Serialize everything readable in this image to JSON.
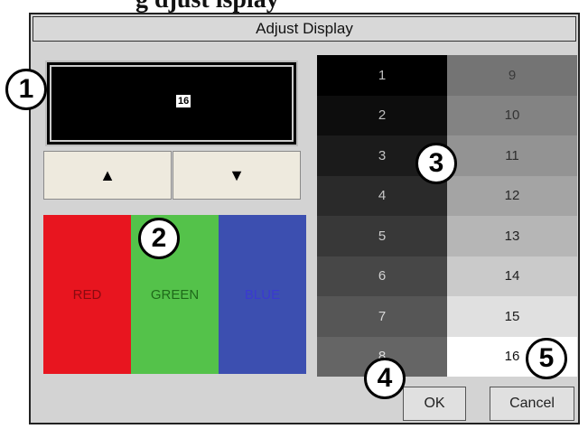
{
  "clipped_title": "g   djust   isplay",
  "window": {
    "title": "Adjust Display"
  },
  "preview": {
    "value": "16"
  },
  "arrows": {
    "up": "▲",
    "down": "▼"
  },
  "swatches": [
    {
      "label": "RED",
      "bg": "#e8151f",
      "fg": "#8a0a10"
    },
    {
      "label": "GREEN",
      "bg": "#54c24a",
      "fg": "#1f6a1a"
    },
    {
      "label": "BLUE",
      "bg": "#3c4fb0",
      "fg": "#3a3ad0"
    }
  ],
  "levels": [
    {
      "n": "1",
      "bg": "#000000",
      "fg": "#bfbfbf"
    },
    {
      "n": "2",
      "bg": "#0d0d0d",
      "fg": "#bfbfbf"
    },
    {
      "n": "3",
      "bg": "#1b1b1b",
      "fg": "#c4c4c4"
    },
    {
      "n": "4",
      "bg": "#2a2a2a",
      "fg": "#c8c8c8"
    },
    {
      "n": "5",
      "bg": "#383838",
      "fg": "#cdcdcd"
    },
    {
      "n": "6",
      "bg": "#474747",
      "fg": "#d2d2d2"
    },
    {
      "n": "7",
      "bg": "#565656",
      "fg": "#d7d7d7"
    },
    {
      "n": "8",
      "bg": "#656565",
      "fg": "#dcdcdc"
    },
    {
      "n": "9",
      "bg": "#747474",
      "fg": "#3a3a3a"
    },
    {
      "n": "10",
      "bg": "#838383",
      "fg": "#333333"
    },
    {
      "n": "11",
      "bg": "#939393",
      "fg": "#2d2d2d"
    },
    {
      "n": "12",
      "bg": "#a4a4a4",
      "fg": "#282828"
    },
    {
      "n": "13",
      "bg": "#b6b6b6",
      "fg": "#222222"
    },
    {
      "n": "14",
      "bg": "#cacaca",
      "fg": "#1e1e1e"
    },
    {
      "n": "15",
      "bg": "#e0e0e0",
      "fg": "#1a1a1a"
    },
    {
      "n": "16",
      "bg": "#ffffff",
      "fg": "#111111"
    }
  ],
  "buttons": {
    "ok": "OK",
    "cancel": "Cancel"
  },
  "callouts": [
    "1",
    "2",
    "3",
    "4",
    "5"
  ]
}
